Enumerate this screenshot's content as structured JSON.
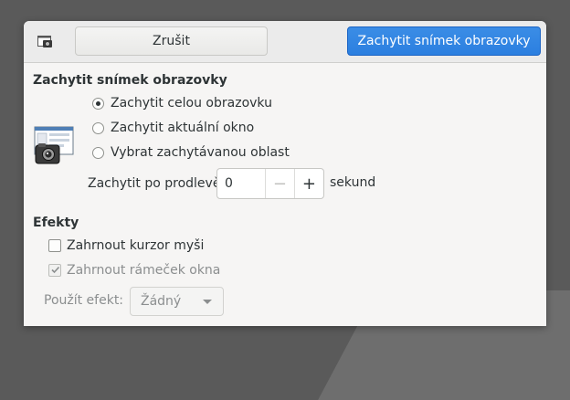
{
  "header": {
    "app_icon": "screenshot-icon",
    "cancel_label": "Zrušit",
    "capture_label": "Zachytit snímek obrazovky"
  },
  "capture": {
    "section_title": "Zachytit snímek obrazovky",
    "options": [
      {
        "label": "Zachytit celou obrazovku",
        "selected": true
      },
      {
        "label": "Zachytit aktuální okno",
        "selected": false
      },
      {
        "label": "Vybrat zachytávanou oblast",
        "selected": false
      }
    ],
    "delay_label": "Zachytit po prodlevě",
    "delay_value": "0",
    "delay_unit": "sekund"
  },
  "effects": {
    "section_title": "Efekty",
    "include_pointer": {
      "label": "Zahrnout kurzor myši",
      "checked": false,
      "enabled": true
    },
    "include_border": {
      "label": "Zahrnout rámeček okna",
      "checked": true,
      "enabled": false
    },
    "apply_effect_label": "Použít efekt:",
    "apply_effect_value": "Žádný"
  },
  "colors": {
    "accent": "#3584e4",
    "background": "#f6f5f4"
  }
}
